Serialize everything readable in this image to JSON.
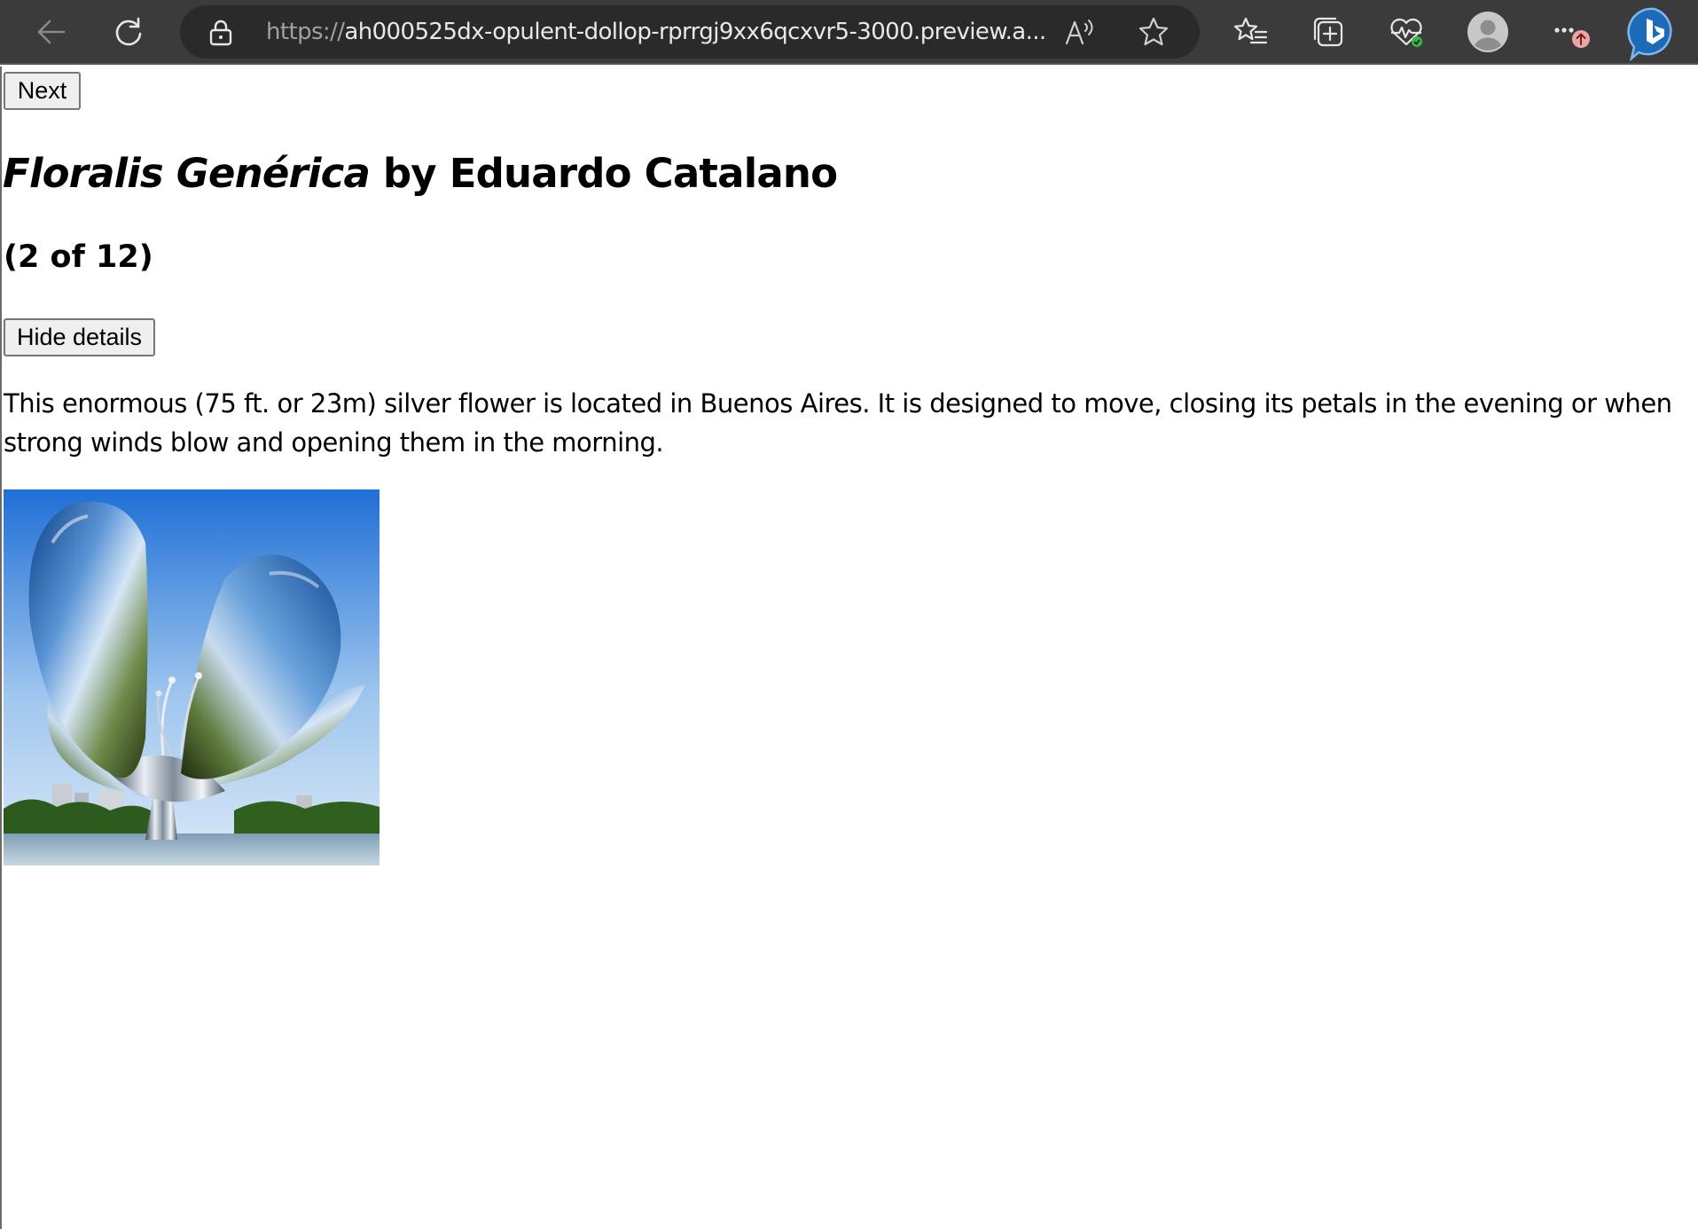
{
  "browser": {
    "url_scheme": "https://",
    "url_rest": "ah000525dx-opulent-dollop-rprrgj9xx6qcxvr5-3000.preview.a...",
    "icons": {
      "back": "arrow-left-icon",
      "refresh": "refresh-icon",
      "lock": "lock-icon",
      "read_aloud": "read-aloud-icon",
      "favorite": "star-icon",
      "favorites": "favorites-list-icon",
      "collections": "collections-icon",
      "health": "browser-essentials-icon",
      "profile": "profile-icon",
      "more": "more-icon",
      "bing": "bing-copilot-icon"
    }
  },
  "gallery": {
    "next_label": "Next",
    "title_name": "Floralis Genérica",
    "title_artist": " by Eduardo Catalano",
    "counter": "(2 of 12)",
    "toggle_label": "Hide details",
    "description": "This enormous (75 ft. or 23m) silver flower is located in Buenos Aires. It is designed to move, closing its petals in the evening or when strong winds blow and opening them in the morning."
  },
  "colors": {
    "chrome_bg": "#3b3b3b",
    "address_bg": "#2a2a2a",
    "button_bg": "#efefef",
    "button_border": "#767676"
  }
}
